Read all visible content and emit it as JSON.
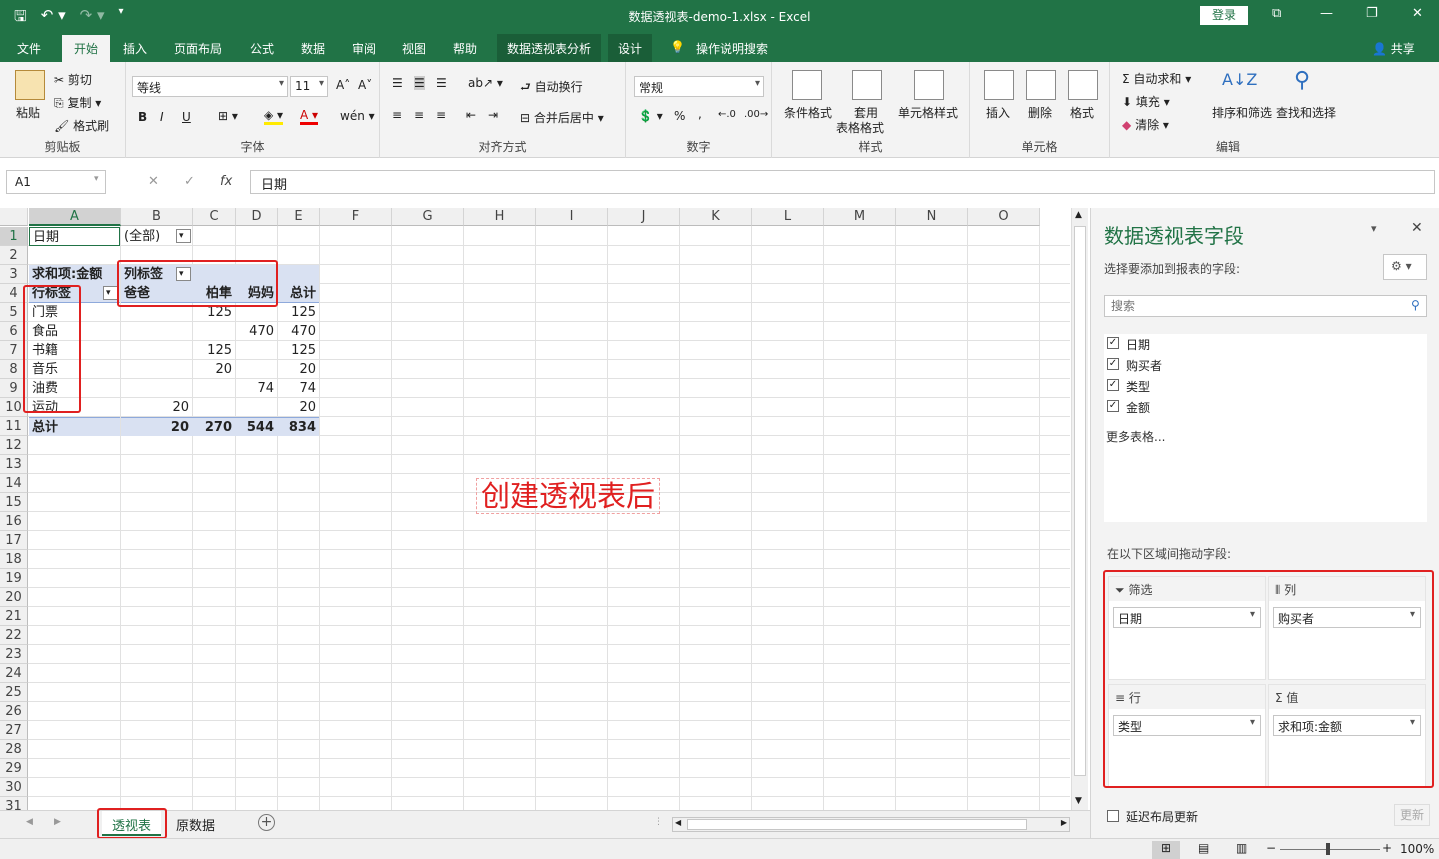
{
  "window": {
    "title": "数据透视表-demo-1.xlsx - Excel",
    "login": "登录",
    "share": "共享"
  },
  "tabs": [
    {
      "label": "文件"
    },
    {
      "label": "开始"
    },
    {
      "label": "插入"
    },
    {
      "label": "页面布局"
    },
    {
      "label": "公式"
    },
    {
      "label": "数据"
    },
    {
      "label": "审阅"
    },
    {
      "label": "视图"
    },
    {
      "label": "帮助"
    },
    {
      "label": "数据透视表分析"
    },
    {
      "label": "设计"
    },
    {
      "label": "操作说明搜索"
    }
  ],
  "ribbon": {
    "clipboard": {
      "paste": "粘贴",
      "cut": "剪切",
      "copy": "复制",
      "painter": "格式刷",
      "label": "剪贴板"
    },
    "font": {
      "name": "等线",
      "size": "11",
      "label": "字体",
      "bold": "B",
      "italic": "I",
      "underline": "U"
    },
    "align": {
      "wrap": "自动换行",
      "merge": "合并后居中",
      "label": "对齐方式"
    },
    "number": {
      "format": "常规",
      "label": "数字",
      "percent": "%",
      "comma": ","
    },
    "styles": {
      "cond": "条件格式",
      "table1": "套用",
      "table2": "表格格式",
      "cell": "单元格样式",
      "label": "样式"
    },
    "cells": {
      "insert": "插入",
      "delete": "删除",
      "format": "格式",
      "label": "单元格"
    },
    "edit": {
      "autosum": "自动求和",
      "fill": "填充",
      "clear": "清除",
      "sort": "排序和筛选",
      "find": "查找和选择",
      "label": "编辑"
    }
  },
  "formula": {
    "namebox": "A1",
    "value": "日期",
    "fx": "fx"
  },
  "columns": [
    "A",
    "B",
    "C",
    "D",
    "E",
    "F",
    "G",
    "H",
    "I",
    "J",
    "K",
    "L",
    "M",
    "N",
    "O"
  ],
  "rows": [
    "1",
    "2",
    "3",
    "4",
    "5",
    "6",
    "7",
    "8",
    "9",
    "10",
    "11",
    "12",
    "13",
    "14",
    "15",
    "16",
    "17",
    "18",
    "19",
    "20",
    "21",
    "22",
    "23",
    "24",
    "25",
    "26",
    "27",
    "28",
    "29",
    "30",
    "31"
  ],
  "pivot": {
    "filter_label": "日期",
    "filter_value": "(全部)",
    "sum_label": "求和项:金额",
    "col_label": "列标签",
    "row_label": "行标签",
    "col_heads": [
      "爸爸",
      "柏隼",
      "妈妈",
      "总计"
    ],
    "rows": [
      {
        "label": "门票",
        "b": "",
        "c": "125",
        "d": "",
        "e": "125"
      },
      {
        "label": "食品",
        "b": "",
        "c": "",
        "d": "470",
        "e": "470"
      },
      {
        "label": "书籍",
        "b": "",
        "c": "125",
        "d": "",
        "e": "125"
      },
      {
        "label": "音乐",
        "b": "",
        "c": "20",
        "d": "",
        "e": "20"
      },
      {
        "label": "油费",
        "b": "",
        "c": "",
        "d": "74",
        "e": "74"
      },
      {
        "label": "运动",
        "b": "20",
        "c": "",
        "d": "",
        "e": "20"
      }
    ],
    "total": {
      "label": "总计",
      "b": "20",
      "c": "270",
      "d": "544",
      "e": "834"
    }
  },
  "annotation": "创建透视表后",
  "pane": {
    "title": "数据透视表字段",
    "subtitle": "选择要添加到报表的字段:",
    "search_placeholder": "搜索",
    "fields": [
      "日期",
      "购买者",
      "类型",
      "金额"
    ],
    "more": "更多表格...",
    "drag_hint": "在以下区域间拖动字段:",
    "areas": {
      "filter": {
        "title": "筛选",
        "item": "日期"
      },
      "column": {
        "title": "列",
        "item": "购买者"
      },
      "row": {
        "title": "行",
        "item": "类型"
      },
      "value": {
        "title": "值",
        "item": "求和项:金额"
      }
    },
    "defer": "延迟布局更新",
    "update": "更新"
  },
  "sheets": [
    "透视表",
    "原数据"
  ],
  "status": {
    "zoom": "100%"
  }
}
